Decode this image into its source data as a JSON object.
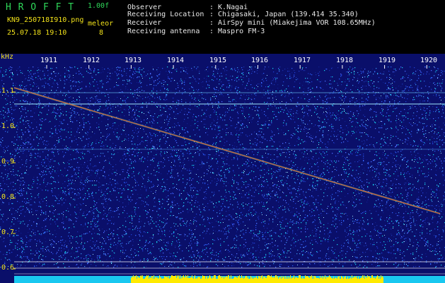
{
  "header": {
    "brand": "H R O F F T",
    "version": "1.00f",
    "filename": "KN9_250718I910.png",
    "datetime": "25.07.18 19:10",
    "counter_label": "meleor",
    "counter_value": "8",
    "fields": [
      {
        "label": "Observer",
        "value": ": K.Nagai"
      },
      {
        "label": "Receiving Location",
        "value": ": Chigasaki, Japan (139.414 35.340)"
      },
      {
        "label": "Receiver",
        "value": ": AirSpy mini (Miakejima VOR 108.65MHz)"
      },
      {
        "label": "Receiving antenna",
        "value": ": Maspro FM-3"
      }
    ]
  },
  "spectrogram": {
    "y_unit": "kHz",
    "y_ticks": [
      "1.1",
      "1.0",
      "0.9",
      "0.8",
      "0.7",
      "0.6"
    ],
    "x_ticks": [
      "1911",
      "1912",
      "1913",
      "1914",
      "1915",
      "1916",
      "1917",
      "1918",
      "1919",
      "1920"
    ],
    "background_color": "#0a0f6a",
    "trace_color": "#ff4a2a",
    "strip_color_low": "#19c8f0",
    "strip_color_high": "#ffea00"
  }
}
